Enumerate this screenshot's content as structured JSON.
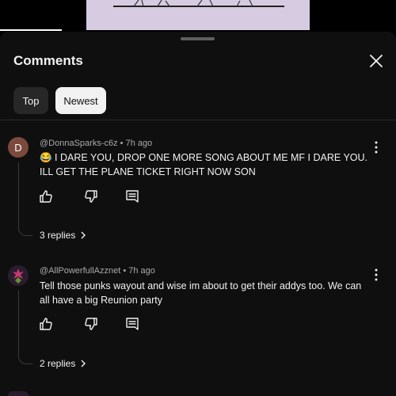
{
  "comments_panel": {
    "title": "Comments",
    "filters": [
      {
        "label": "Top",
        "selected": false
      },
      {
        "label": "Newest",
        "selected": true
      }
    ]
  },
  "comments": [
    {
      "avatar_letter": "D",
      "author": "@DonnaSparks-c6z",
      "separator": "•",
      "time": "7h ago",
      "text": "😂 I DARE YOU, DROP ONE MORE SONG ABOUT ME MF I DARE YOU.  ILL GET THE PLANE TICKET RIGHT NOW SON",
      "replies_label": "3 replies"
    },
    {
      "author": "@AllPowerfullAzznet",
      "separator": "•",
      "time": "7h ago",
      "text": "Tell those punks wayout and wise im about to get their addys too. We can all have a big Reunion party",
      "replies_label": "2 replies"
    }
  ],
  "colors": {
    "sheet_bg": "#0f0f0f",
    "chip_selected_bg": "#f1f1f1",
    "chip_bg": "#272727",
    "secondary_text": "#aaaaaa"
  }
}
